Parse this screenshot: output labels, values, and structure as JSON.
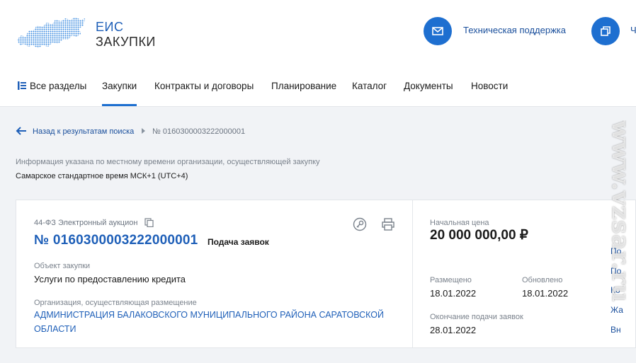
{
  "header": {
    "logo_line1": "ЕИС",
    "logo_line2": "ЗАКУПКИ",
    "support_label": "Техническая поддержка",
    "second_label_cut": "Ч",
    "accent_color": "#1e6fd0"
  },
  "nav": {
    "items": [
      {
        "label": "Все разделы",
        "icon": "sections-icon"
      },
      {
        "label": "Закупки",
        "active": true
      },
      {
        "label": "Контракты и договоры"
      },
      {
        "label": "Планирование"
      },
      {
        "label": "Каталог"
      },
      {
        "label": "Документы"
      },
      {
        "label": "Новости"
      }
    ]
  },
  "breadcrumb": {
    "back_label": "Назад к результатам поиска",
    "current": "№ 0160300003222000001"
  },
  "timezone": {
    "note": "Информация указана по местному времени организации, осуществляющей закупку",
    "value": "Самарское стандартное время МСК+1 (UTC+4)"
  },
  "procurement": {
    "law_type": "44-ФЗ  Электронный аукцион",
    "number": "№ 0160300003222000001",
    "status": "Подача заявок",
    "object_label": "Объект закупки",
    "object_value": "Услуги по предоставлению кредита",
    "org_label": "Организация, осуществляющая размещение",
    "org_value": "АДМИНИСТРАЦИЯ БАЛАКОВСКОГО МУНИЦИПАЛЬНОГО РАЙОНА САРАТОВСКОЙ ОБЛАСТИ"
  },
  "summary": {
    "price_label": "Начальная цена",
    "price_value": "20 000 000,00 ₽",
    "placed_label": "Размещено",
    "placed_value": "18.01.2022",
    "updated_label": "Обновлено",
    "updated_value": "18.01.2022",
    "deadline_label": "Окончание подачи заявок",
    "deadline_value": "28.01.2022"
  },
  "side_links": [
    "По",
    "По",
    "Ко",
    "Жа",
    "Вн"
  ],
  "watermark": "www.vzsar.ru"
}
